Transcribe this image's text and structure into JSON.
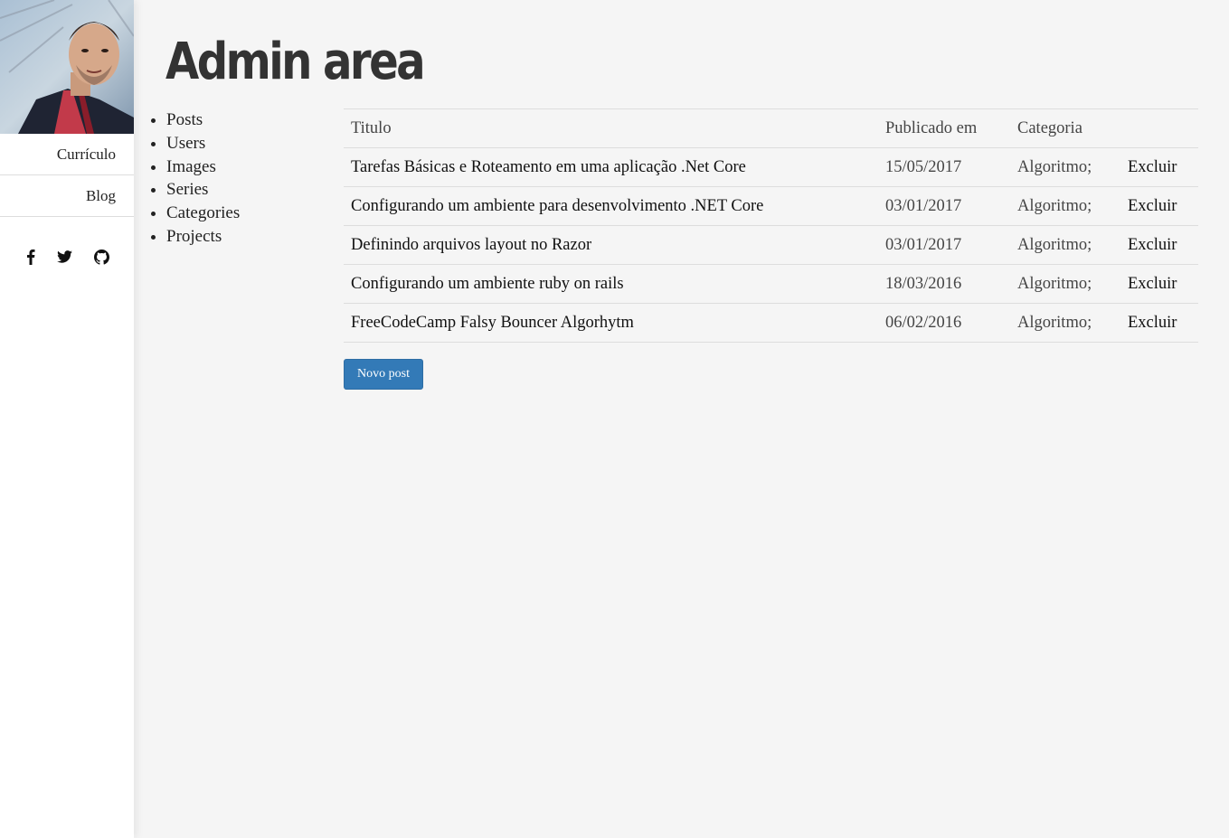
{
  "sidebar": {
    "links": [
      {
        "label": "Currículo"
      },
      {
        "label": "Blog"
      }
    ],
    "social_icons": [
      "facebook-icon",
      "twitter-icon",
      "github-icon"
    ]
  },
  "main": {
    "title": "Admin area",
    "nav": [
      "Posts",
      "Users",
      "Images",
      "Series",
      "Categories",
      "Projects"
    ],
    "table": {
      "headers": [
        "Titulo",
        "Publicado em",
        "Categoria",
        ""
      ],
      "rows": [
        {
          "title": "Tarefas Básicas e Roteamento em uma aplicação .Net Core",
          "date": "15/05/2017",
          "category": "Algoritmo;",
          "action": "Excluir"
        },
        {
          "title": "Configurando um ambiente para desenvolvimento .NET Core",
          "date": "03/01/2017",
          "category": "Algoritmo;",
          "action": "Excluir"
        },
        {
          "title": "Definindo arquivos layout no Razor",
          "date": "03/01/2017",
          "category": "Algoritmo;",
          "action": "Excluir"
        },
        {
          "title": "Configurando um ambiente ruby on rails",
          "date": "18/03/2016",
          "category": "Algoritmo;",
          "action": "Excluir"
        },
        {
          "title": "FreeCodeCamp Falsy Bouncer Algorhytm",
          "date": "06/02/2016",
          "category": "Algoritmo;",
          "action": "Excluir"
        }
      ]
    },
    "new_post_button": "Novo post"
  },
  "colors": {
    "primary_button": "#337ab7",
    "page_background": "#f5f5f5",
    "sidebar_background": "#ffffff"
  }
}
